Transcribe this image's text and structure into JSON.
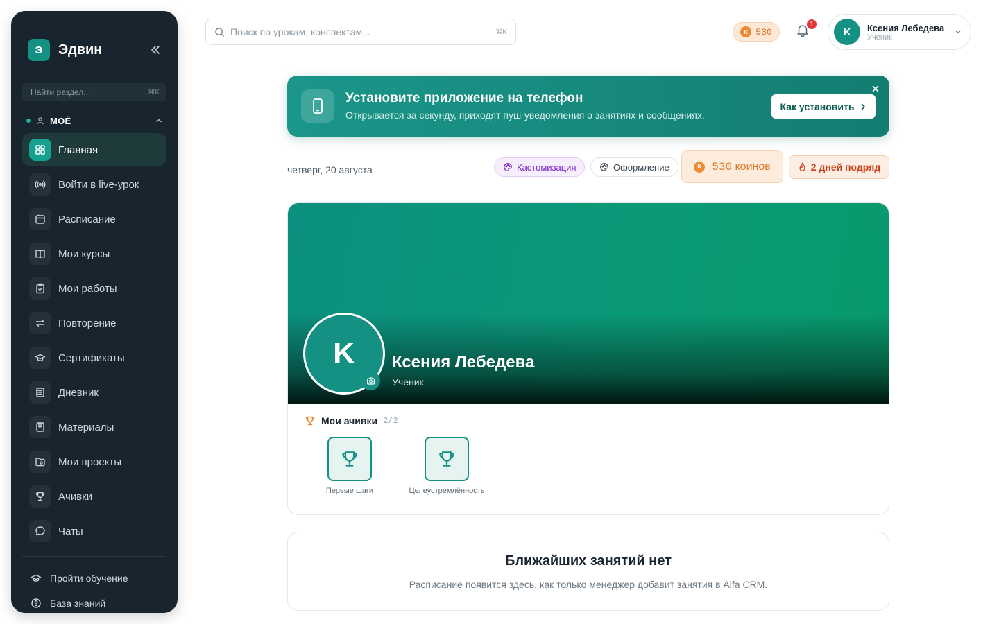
{
  "sidebar": {
    "brand_letter": "Э",
    "brand_name": "Эдвин",
    "search_placeholder": "Найти раздел...",
    "search_shortcut": "⌘K",
    "section_title": "МОЁ",
    "items": [
      {
        "label": "Главная",
        "icon": "grid-icon"
      },
      {
        "label": "Войти в live-урок",
        "icon": "broadcast-icon"
      },
      {
        "label": "Расписание",
        "icon": "calendar-icon"
      },
      {
        "label": "Мои курсы",
        "icon": "book-icon"
      },
      {
        "label": "Мои работы",
        "icon": "clipboard-icon"
      },
      {
        "label": "Повторение",
        "icon": "repeat-icon"
      },
      {
        "label": "Сертификаты",
        "icon": "graduation-cap-icon"
      },
      {
        "label": "Дневник",
        "icon": "notebook-icon"
      },
      {
        "label": "Материалы",
        "icon": "bookmark-icon"
      },
      {
        "label": "Мои проекты",
        "icon": "folder-icon"
      },
      {
        "label": "Ачивки",
        "icon": "trophy-icon"
      },
      {
        "label": "Чаты",
        "icon": "chat-icon"
      }
    ],
    "footer": [
      {
        "label": "Пройти обучение",
        "icon": "graduation-cap-icon"
      },
      {
        "label": "База знаний",
        "icon": "help-circle-icon"
      }
    ]
  },
  "header": {
    "search_placeholder": "Поиск по урокам, конспектам...",
    "search_shortcut": "⌘K",
    "coin_letter": "K",
    "coins": "530",
    "notifications": "1",
    "user": {
      "initial": "K",
      "name": "Ксения Лебедева",
      "role": "Ученик"
    }
  },
  "banner": {
    "title": "Установите приложение на телефон",
    "text": "Открывается за секунду, приходят пуш-уведомления о занятиях и сообщениях.",
    "button": "Как установить"
  },
  "date_row": {
    "date": "четверг, 20 августа",
    "chip_custom": "Кастомизация",
    "chip_design": "Оформление",
    "coins_value": "530",
    "coins_unit": "коинов",
    "streak": "2 дней подряд"
  },
  "profile": {
    "initial": "K",
    "name": "Ксения Лебедева",
    "role": "Ученик",
    "achievements_title": "Мои ачивки",
    "achievements_count": "2/2",
    "achievements": [
      {
        "label": "Первые шаги"
      },
      {
        "label": "Целеустремлённость"
      }
    ]
  },
  "lessons": {
    "title": "Ближайших занятий нет",
    "text": "Расписание появится здесь, как только менеджер добавит занятия в Alfa CRM."
  },
  "colors": {
    "accent": "#149183",
    "sidebar_bg": "#18242e",
    "coin": "#ee8a35",
    "badge": "#e23a3a"
  }
}
